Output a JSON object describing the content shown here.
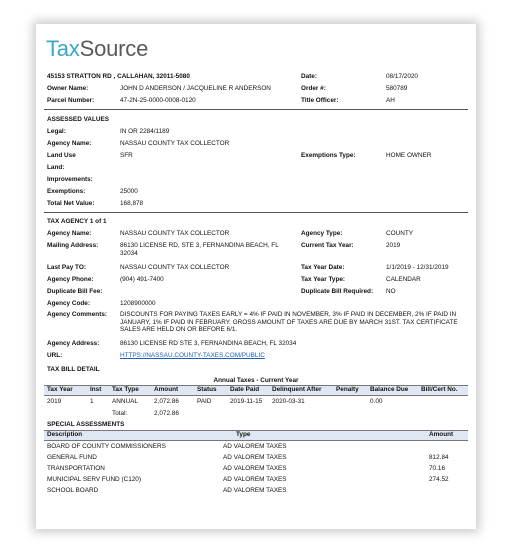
{
  "logo": {
    "part1": "Tax",
    "part2": "Source"
  },
  "header": {
    "address": "45153 STRATTON RD , CALLAHAN, 32011-5080",
    "owner_label": "Owner Name:",
    "owner": "JOHN D ANDERSON / JACQUELINE R ANDERSON",
    "parcel_label": "Parcel Number:",
    "parcel": "47-2N-25-0000-0008-0120",
    "date_label": "Date:",
    "date": "08/17/2020",
    "order_label": "Order #:",
    "order": "580789",
    "title_label": "Title Officer:",
    "title_officer": "AH"
  },
  "assessed": {
    "heading": "ASSESSED VALUES",
    "legal_label": "Legal:",
    "legal": "IN OR 2284/1189",
    "agency_label": "Agency Name:",
    "agency": "NASSAU COUNTY TAX COLLECTOR",
    "land_use_label": "Land Use",
    "land_use": "SFR",
    "exemptions_type_label": "Exemptions Type:",
    "exemptions_type": "HOME OWNER",
    "land_label": "Land:",
    "improvements_label": "Improvements:",
    "exemptions_label": "Exemptions:",
    "exemptions": "25000",
    "total_label": "Total Net Value:",
    "total": "168,878"
  },
  "agency": {
    "heading": "TAX AGENCY 1 of 1",
    "name_label": "Agency Name:",
    "name": "NASSAU COUNTY TAX COLLECTOR",
    "mailing_label": "Mailing Address:",
    "mailing": "86130 LICENSE RD, STE 3, FERNANDINA BEACH, FL 32034",
    "lastpay_label": "Last Pay TO:",
    "lastpay": "NASSAU COUNTY TAX COLLECTOR",
    "phone_label": "Agency Phone:",
    "phone": "(904) 491-7400",
    "dup_fee_label": "Duplicate Bill Fee:",
    "code_label": "Agency Code:",
    "code": "1208900000",
    "comments_label": "Agency Comments:",
    "comments": "DISCOUNTS FOR PAYING TAXES EARLY = 4% IF PAID IN NOVEMBER, 3% IF PAID IN DECEMBER, 2% IF PAID IN JANUARY, 1% IF PAID IN FEBRUARY. GROSS AMOUNT OF TAXES ARE DUE BY MARCH 31ST. TAX CERTIFICATE SALES ARE HELD ON OR BEFORE 6/1.",
    "address_label": "Agency Address:",
    "address": "86130 LICENSE RD STE 3, FERNANDINA BEACH, FL 32034",
    "url_label": "URL:",
    "url": "HTTPS://NASSAU.COUNTY-TAXES.COM/PUBLIC",
    "type_label": "Agency Type:",
    "type": "COUNTY",
    "current_year_label": "Current Tax Year:",
    "current_year": "2019",
    "tax_year_date_label": "Tax Year Date:",
    "tax_year_date": "1/1/2019 - 12/31/2019",
    "tax_year_type_label": "Tax Year Type:",
    "tax_year_type": "CALENDAR",
    "dup_required_label": "Duplicate Bill Required:",
    "dup_required": "NO"
  },
  "bill": {
    "heading": "TAX BILL DETAIL",
    "subheading": "Annual Taxes - Current Year",
    "columns": [
      "Tax Year",
      "Inst",
      "Tax Type",
      "Amount",
      "Status",
      "Date Paid",
      "Delinquent After",
      "Penalty",
      "Balance Due",
      "Bill/Cert No."
    ],
    "row": [
      "2019",
      "1",
      "ANNUAL",
      "2,072.86",
      "PAID",
      "2019-11-15",
      "2020-03-31",
      "",
      "0.00",
      ""
    ],
    "total_label": "Total:",
    "total": "2,072.86"
  },
  "special": {
    "heading": "SPECIAL ASSESSMENTS",
    "columns": [
      "Description",
      "Type",
      "Amount"
    ],
    "rows": [
      {
        "description": "BOARD OF COUNTY COMMISSIONERS",
        "type": "AD VALOREM TAXES",
        "amount": ""
      },
      {
        "description": "GENERAL FUND",
        "type": "AD VALOREM TAXES",
        "amount": "812.84"
      },
      {
        "description": "TRANSPORTATION",
        "type": "AD VALOREM TAXES",
        "amount": "70.16"
      },
      {
        "description": "MUNICIPAL SERV FUND (C120)",
        "type": "AD VALOREM TAXES",
        "amount": "274.52"
      },
      {
        "description": "SCHOOL BOARD",
        "type": "AD VALOREM TAXES",
        "amount": ""
      }
    ]
  },
  "colors": {
    "logo_tax": "#3aa6c8",
    "logo_source": "#5a5a5a",
    "link": "#1f5fb5",
    "table_header_bg": "#dfe8f2"
  }
}
